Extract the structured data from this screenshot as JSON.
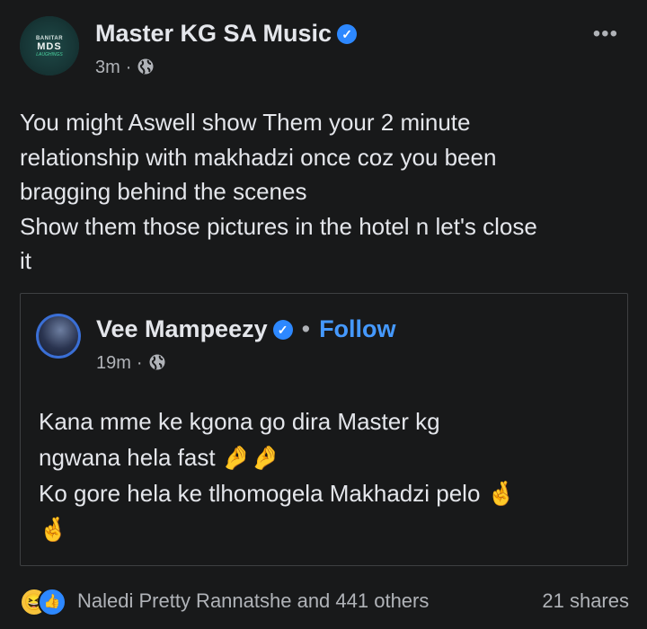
{
  "post": {
    "author": "Master KG SA Music",
    "avatar_text": {
      "top": "BANITAR",
      "main": "MDS",
      "sub": "LAUGHINGS"
    },
    "time": "3m",
    "separator": "·",
    "more_label": "•••",
    "text_lines": [
      "You might Aswell show Them your 2 minute",
      "relationship with makhadzi once coz you been",
      "bragging behind the scenes",
      "Show them those pictures in the hotel n let's close",
      "it"
    ]
  },
  "shared_post": {
    "author": "Vee Mampeezy",
    "dot": "•",
    "follow_label": "Follow",
    "time": "19m",
    "separator": "·",
    "text_lines": [
      "Kana mme ke kgona go dira Master  kg",
      "ngwana hela fast 🤌🤌",
      "Ko gore hela ke tlhomogela Makhadzi pelo 🤞",
      "🤞"
    ]
  },
  "footer": {
    "reaction_icons": [
      "haha-icon",
      "like-icon"
    ],
    "reactors": "Naledi Pretty Rannatshe and 441 others",
    "shares": "21 shares"
  },
  "colors": {
    "background": "#18191a",
    "text": "#e4e6eb",
    "secondary": "#b0b3b8",
    "verified": "#2d88ff",
    "follow": "#4599ff"
  }
}
